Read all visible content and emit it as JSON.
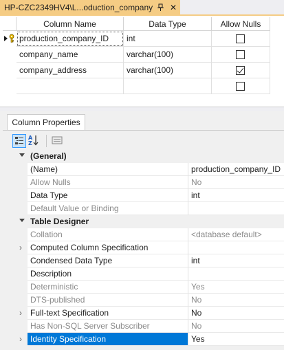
{
  "document_tab": {
    "title": "HP-CZC2349HV4\\L...oduction_company",
    "pin_icon": "pin-icon",
    "close_icon": "close-icon"
  },
  "designer": {
    "headers": [
      "Column Name",
      "Data Type",
      "Allow Nulls"
    ],
    "rows": [
      {
        "name": "production_company_ID",
        "type": "int",
        "allow_nulls": false,
        "primary_key": true,
        "current": true
      },
      {
        "name": "company_name",
        "type": "varchar(100)",
        "allow_nulls": false,
        "primary_key": false,
        "current": false
      },
      {
        "name": "company_address",
        "type": "varchar(100)",
        "allow_nulls": true,
        "primary_key": false,
        "current": false
      },
      {
        "name": "",
        "type": "",
        "allow_nulls": false,
        "primary_key": false,
        "current": false
      }
    ]
  },
  "properties": {
    "tab_label": "Column Properties",
    "toolbar": [
      "categorized-icon",
      "alphabetical-icon",
      "property-pages-icon"
    ],
    "rows": [
      {
        "kind": "category",
        "name": "(General)"
      },
      {
        "kind": "prop",
        "name": "(Name)",
        "value": "production_company_ID",
        "disabled": false,
        "expandable": false
      },
      {
        "kind": "prop",
        "name": "Allow Nulls",
        "value": "No",
        "disabled": true,
        "expandable": false
      },
      {
        "kind": "prop",
        "name": "Data Type",
        "value": "int",
        "disabled": false,
        "expandable": false
      },
      {
        "kind": "prop",
        "name": "Default Value or Binding",
        "value": "",
        "disabled": true,
        "expandable": false
      },
      {
        "kind": "category",
        "name": "Table Designer"
      },
      {
        "kind": "prop",
        "name": "Collation",
        "value": "<database default>",
        "disabled": true,
        "expandable": false
      },
      {
        "kind": "prop",
        "name": "Computed Column Specification",
        "value": "",
        "disabled": false,
        "expandable": true
      },
      {
        "kind": "prop",
        "name": "Condensed Data Type",
        "value": "int",
        "disabled": false,
        "expandable": false
      },
      {
        "kind": "prop",
        "name": "Description",
        "value": "",
        "disabled": false,
        "expandable": false
      },
      {
        "kind": "prop",
        "name": "Deterministic",
        "value": "Yes",
        "disabled": true,
        "expandable": false
      },
      {
        "kind": "prop",
        "name": "DTS-published",
        "value": "No",
        "disabled": true,
        "expandable": false
      },
      {
        "kind": "prop",
        "name": "Full-text Specification",
        "value": "No",
        "disabled": false,
        "expandable": true
      },
      {
        "kind": "prop",
        "name": "Has Non-SQL Server Subscriber",
        "value": "No",
        "disabled": true,
        "expandable": false
      },
      {
        "kind": "prop",
        "name": "Identity Specification",
        "value": "Yes",
        "disabled": false,
        "expandable": true,
        "selected": true
      }
    ]
  },
  "colors": {
    "tab_active": "#f5cc84",
    "selection": "#0078d7"
  }
}
